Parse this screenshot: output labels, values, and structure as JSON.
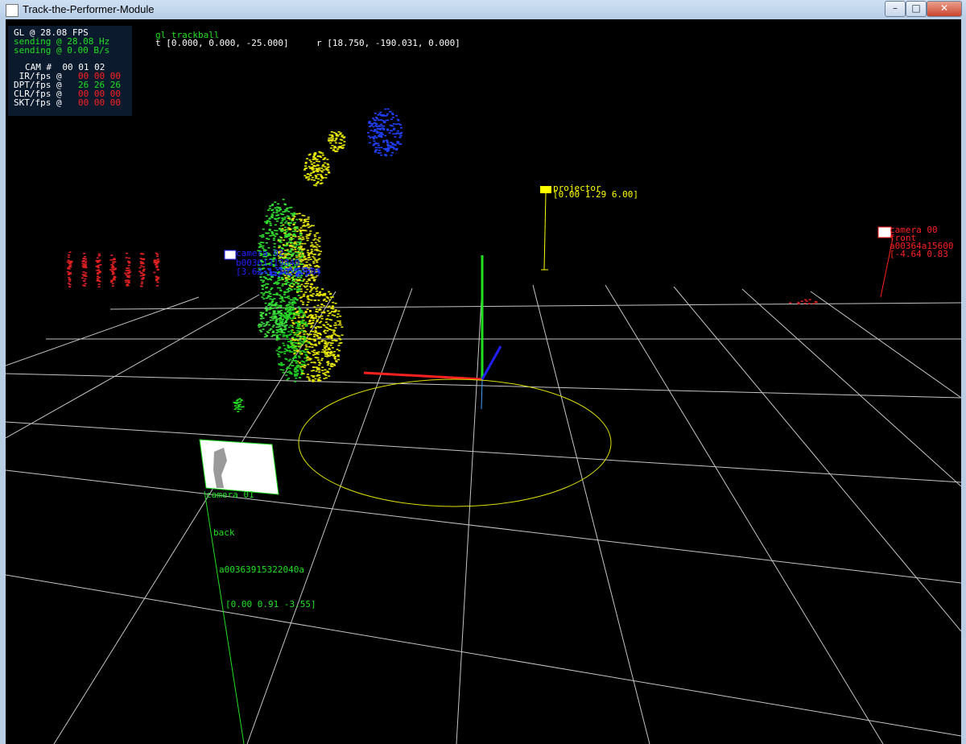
{
  "window": {
    "title": "Track-the-Performer-Module"
  },
  "hud": {
    "fps": "GL @ 28.08 FPS",
    "sending_hz": "sending @ 28.08 Hz",
    "sending_bps": "sending @ 0.00 B/s",
    "cam_header": "CAM #  00 01 02",
    "rows": [
      {
        "label": " IR/fps @",
        "values": "00 00 00",
        "color": "#ff2020"
      },
      {
        "label": "DPT/fps @",
        "values": "26 26 26",
        "color": "#20e020"
      },
      {
        "label": "CLR/fps @",
        "values": "00 00 00",
        "color": "#ff2020"
      },
      {
        "label": "SKT/fps @",
        "values": "00 00 00",
        "color": "#ff2020"
      }
    ]
  },
  "trackball": {
    "label": "gl trackball",
    "t": "t [0.000, 0.000, -25.000]",
    "r": "r [18.750, -190.031, 0.000]"
  },
  "projector": {
    "name": "projector",
    "pos": "[0.00 1.29 6.00]"
  },
  "camera00": {
    "name": "camera 00",
    "side": "front",
    "serial": "a00364a15600",
    "pos": "[-4.64 0.83"
  },
  "camera02": {
    "name": "camera 02",
    "line2": "b00361319840",
    "line3": "[3.62 1.30 2.60]"
  },
  "camera01": {
    "name": "camera 01",
    "side": "back",
    "serial": "a00363915322040a",
    "pos": "[0.00 0.91 -3.55]"
  },
  "colors": {
    "green": "#20e020",
    "yellow": "#ffff00",
    "red": "#ff2020",
    "blue": "#2020ff",
    "grid": "#e8e8e8"
  }
}
